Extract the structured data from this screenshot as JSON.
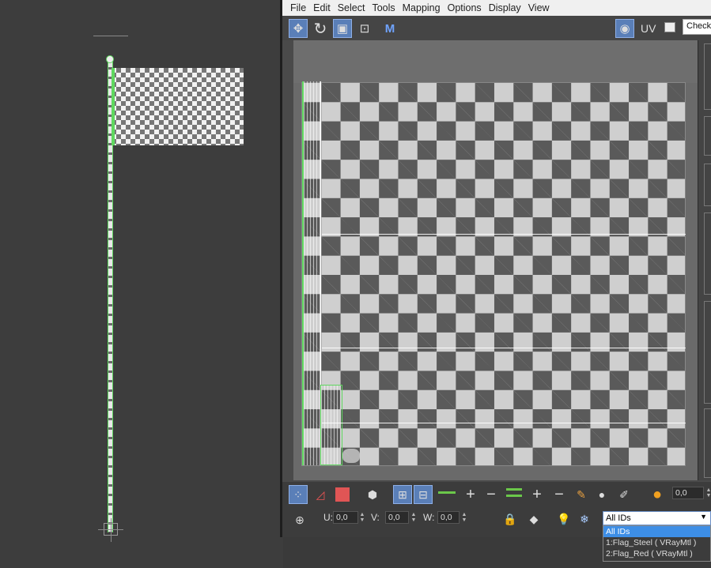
{
  "menu": [
    "File",
    "Edit",
    "Select",
    "Tools",
    "Mapping",
    "Options",
    "Display",
    "View"
  ],
  "toolbar": {
    "uv_label": "UV",
    "map_select": "Checker"
  },
  "transform": {
    "u_label": "U:",
    "u_value": "0,0",
    "v_label": "V:",
    "v_value": "0,0",
    "w_label": "W:",
    "w_value": "0,0"
  },
  "soft": {
    "value": "0,0"
  },
  "ids": {
    "selected": "All IDs",
    "options": [
      "All IDs",
      "1:Flag_Steel  ( VRayMtl )",
      "2:Flag_Red  ( VRayMtl )"
    ]
  },
  "icons": {
    "move": "move-icon",
    "rotate": "rotate-icon",
    "scale": "scale-icon",
    "freeform": "freeform-icon",
    "mirror": "mirror-icon",
    "checker": "checker-icon",
    "lock": "lock-icon",
    "snowflake": "freeze-icon"
  },
  "colors": {
    "accent": "#5a7fb8",
    "uv_edge": "#5fd85f",
    "selected_option": "#3d8ee6"
  }
}
